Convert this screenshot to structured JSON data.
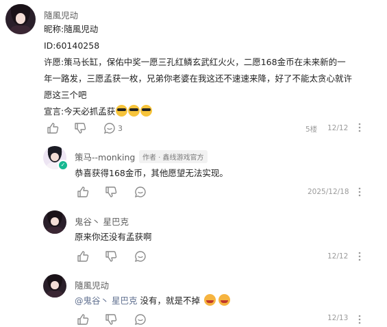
{
  "icons": {
    "like": "thumbs-up-icon",
    "dislike": "thumbs-down-icon",
    "reply": "comment-icon",
    "more": "more-vertical-icon"
  },
  "comments": [
    {
      "author": "隨風児动",
      "lines": [
        "昵称:隨風児动",
        "ID:60140258",
        "许愿:策马长缸，保佑中奖一愿三孔红鳞玄武红火火，二愿168金币在未来新的一",
        "年一路发，三愿孟获一枚，兄弟你老婆在我这还不速速来降，好了不能太贪心就许",
        "愿这三个吧",
        "宣言:今天必抓孟获"
      ],
      "reply_count": "3",
      "floor": "5楼",
      "date": "12/12"
    },
    {
      "author": "策马--monking",
      "badge": "作者 · 鑫线游戏官方",
      "text": "恭喜获得168金币，其他愿望无法实现。",
      "date": "2025/12/18"
    },
    {
      "author": "鬼谷丶 星巴克",
      "text": "原来你还没有孟获啊",
      "date": "12/12"
    },
    {
      "author": "隨風児动",
      "mention": "@鬼谷丶 星巴克",
      "text": " 没有，就是不掉",
      "date": "12/13"
    }
  ]
}
